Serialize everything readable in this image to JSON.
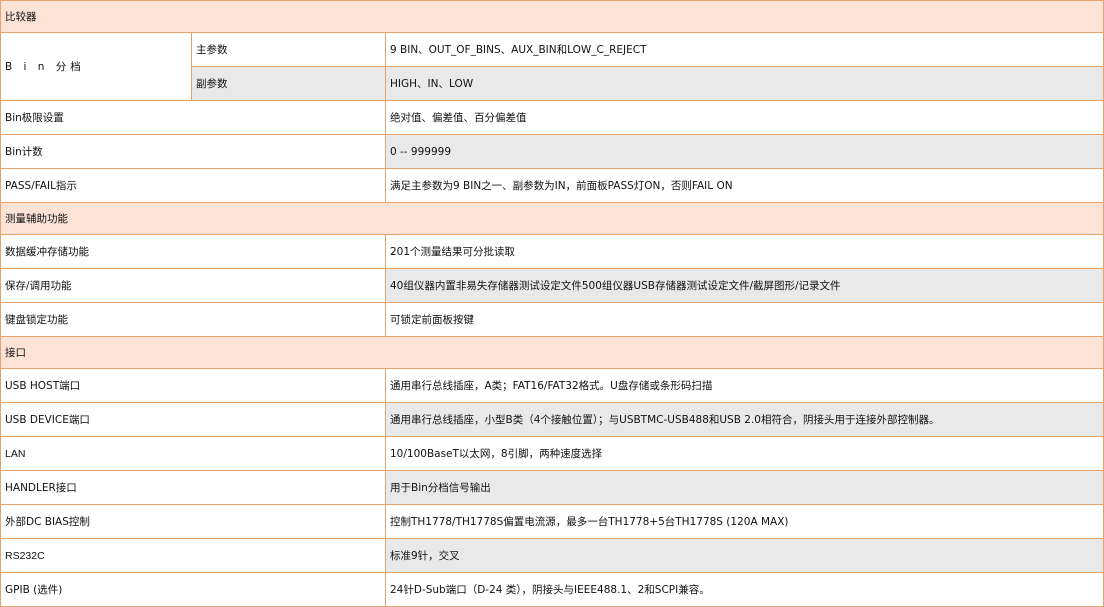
{
  "sections": {
    "comparator": "比较器",
    "measurement_aux": "测量辅助功能",
    "interface": "接口"
  },
  "rows": {
    "bin_sort": {
      "label": "B i n 分档",
      "main_param": {
        "label": "主参数",
        "value": "9 BIN、OUT_OF_BINS、AUX_BIN和LOW_C_REJECT"
      },
      "sub_param": {
        "label": "副参数",
        "value": "HIGH、IN、LOW"
      }
    },
    "bin_limit": {
      "label": "Bin极限设置",
      "value": "绝对值、偏差值、百分偏差值"
    },
    "bin_count": {
      "label": "Bin计数",
      "value": "0 -- 999999"
    },
    "pass_fail": {
      "label": "PASS/FAIL指示",
      "value": "满足主参数为9 BIN之一、副参数为IN，前面板PASS灯ON，否则FAIL ON"
    },
    "data_buffer": {
      "label": "数据缓冲存储功能",
      "value": "201个测量结果可分批读取"
    },
    "save_recall": {
      "label": "保存/调用功能",
      "value": "40组仪器内置非易失存储器测试设定文件500组仪器USB存储器测试设定文件/截屏图形/记录文件"
    },
    "key_lock": {
      "label": "键盘锁定功能",
      "value": "可锁定前面板按键"
    },
    "usb_host": {
      "label": "USB HOST端口",
      "value": "通用串行总线插座，A类；FAT16/FAT32格式。U盘存储或条形码扫描"
    },
    "usb_device": {
      "label": "USB DEVICE端口",
      "value": "通用串行总线插座，小型B类（4个接触位置）；与USBTMC-USB488和USB 2.0相符合，阴接头用于连接外部控制器。"
    },
    "lan": {
      "label": "LAN",
      "value": "10/100BaseT以太网，8引脚，两种速度选择"
    },
    "handler": {
      "label": "HANDLER接口",
      "value": "用于Bin分档信号输出"
    },
    "dc_bias": {
      "label": "外部DC BIAS控制",
      "value": "控制TH1778/TH1778S偏置电流源，最多一台TH1778+5台TH1778S (120A MAX)"
    },
    "rs232c": {
      "label": "RS232C",
      "value": "标准9针，交叉"
    },
    "gpib": {
      "label": "GPIB (选件)",
      "value": "24针D-Sub端口（D-24 类），阴接头与IEEE488.1、2和SCPI兼容。"
    }
  }
}
